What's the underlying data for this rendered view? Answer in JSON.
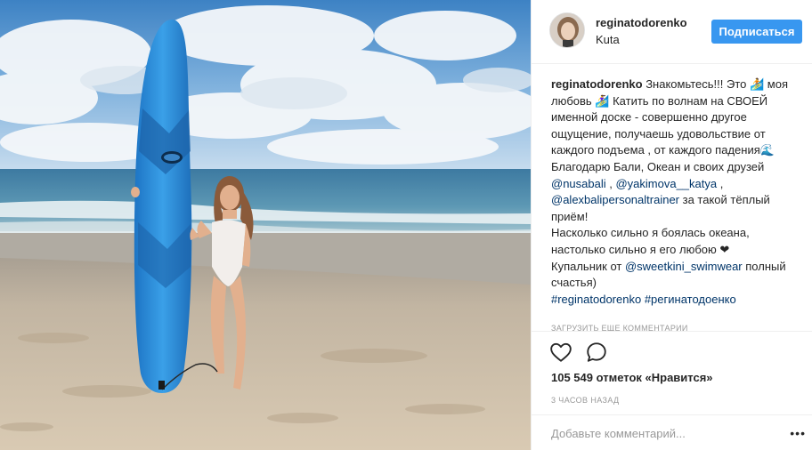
{
  "post": {
    "username": "reginatodorenko",
    "location": "Kuta",
    "follow_label": "Подписаться",
    "caption_author": "reginatodorenko",
    "caption_line1": "Знакомьтесь!!! Это 🏄 моя любовь 🏄‍♀️ Катить по волнам на СВОЕЙ именной доске - совершенно другое ощущение, получаешь удовольствие от каждого подъема , от каждого падения🌊",
    "caption_line2": "Благодарю Бали, Океан и своих друзей",
    "mention1": "@nusabali",
    "sep1": " , ",
    "mention2": "@yakimova__katya",
    "sep2": " , ",
    "mention3": "@alexbalipersonaltrainer",
    "caption_line3": " за такой тёплый приём!",
    "caption_line4": "Насколько сильно я боялась океана, настолько сильно я его любою ❤",
    "caption_line5_prefix": "Купальник от ",
    "mention4": "@sweetkini_swimwear",
    "caption_line5_suffix": " полный счастья)",
    "hashtag1": "#reginatodorenko",
    "hashtag2": "#регинатодоенко",
    "more_comments_hint": "ЗАГРУЗИТЬ ЕЩЕ КОММЕНТАРИИ",
    "likes": "105 549 отметок «Нравится»",
    "time": "3 ЧАСОВ НАЗАД",
    "comment_placeholder": "Добавьте комментарий...",
    "more_label": "•••"
  },
  "icons": {
    "like": "heart-icon",
    "comment": "comment-icon",
    "more": "more-icon"
  },
  "colors": {
    "accent": "#3897f0",
    "link": "#003569",
    "muted": "#999999"
  }
}
